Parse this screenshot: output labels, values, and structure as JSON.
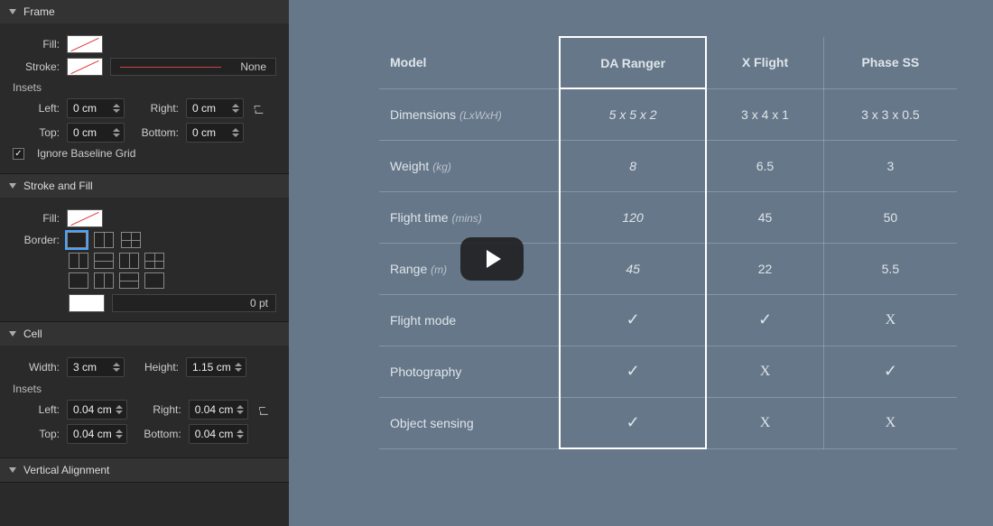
{
  "panels": {
    "frame": {
      "title": "Frame",
      "fill_label": "Fill:",
      "stroke_label": "Stroke:",
      "stroke_style": "None",
      "insets_label": "Insets",
      "left_label": "Left:",
      "right_label": "Right:",
      "top_label": "Top:",
      "bottom_label": "Bottom:",
      "left": "0 cm",
      "right": "0 cm",
      "top": "0 cm",
      "bottom": "0 cm",
      "ignore_baseline": "Ignore Baseline Grid"
    },
    "strokefill": {
      "title": "Stroke and Fill",
      "fill_label": "Fill:",
      "border_label": "Border:",
      "pt_value": "0 pt"
    },
    "cell": {
      "title": "Cell",
      "width_label": "Width:",
      "height_label": "Height:",
      "width": "3 cm",
      "height": "1.15 cm",
      "insets_label": "Insets",
      "left_label": "Left:",
      "right_label": "Right:",
      "top_label": "Top:",
      "bottom_label": "Bottom:",
      "left": "0.04 cm",
      "right": "0.04 cm",
      "top": "0.04 cm",
      "bottom": "0.04 cm"
    },
    "valign": {
      "title": "Vertical Alignment"
    }
  },
  "chart_data": {
    "type": "table",
    "row_header": "Model",
    "columns": [
      "DA Ranger",
      "X Flight",
      "Phase SS"
    ],
    "rows": [
      {
        "label": "Dimensions",
        "unit": "(LxWxH)",
        "values": [
          "5 x 5 x 2",
          "3 x 4 x 1",
          "3 x 3 x 0.5"
        ]
      },
      {
        "label": "Weight",
        "unit": "(kg)",
        "values": [
          "8",
          "6.5",
          "3"
        ]
      },
      {
        "label": "Flight time",
        "unit": "(mins)",
        "values": [
          "120",
          "45",
          "50"
        ]
      },
      {
        "label": "Range",
        "unit": "(m)",
        "values": [
          "45",
          "22",
          "5.5"
        ]
      },
      {
        "label": "Flight mode",
        "unit": "",
        "values": [
          "check",
          "check",
          "cross"
        ]
      },
      {
        "label": "Photography",
        "unit": "",
        "values": [
          "check",
          "cross",
          "check"
        ]
      },
      {
        "label": "Object sensing",
        "unit": "",
        "values": [
          "check",
          "cross",
          "cross"
        ]
      }
    ],
    "highlighted_column": "DA Ranger"
  }
}
